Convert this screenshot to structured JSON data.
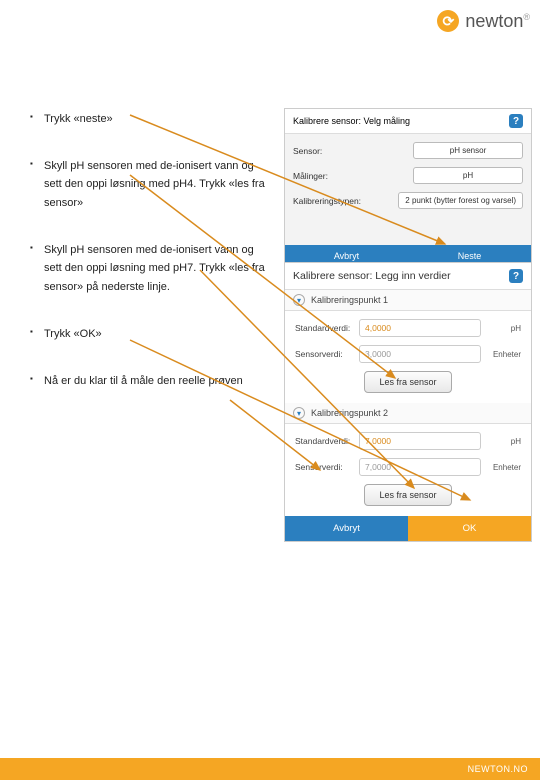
{
  "header": {
    "logo_glyph": "⟳",
    "logo_text": "newton",
    "logo_reg": "®"
  },
  "bullets": [
    "Trykk «neste»",
    "Skyll pH sensoren med de-ionisert vann og sett den oppi løsning med pH4. Trykk «les fra sensor»",
    "Skyll pH sensoren med de-ionisert vann og sett den oppi løsning med pH7. Trykk «les fra sensor» på nederste linje.",
    "Trykk «OK»",
    "Nå er du klar til å måle den reelle prøven"
  ],
  "panel1": {
    "title": "Kalibrere sensor: Velg måling",
    "rows": [
      {
        "label": "Sensor:",
        "value": "pH sensor"
      },
      {
        "label": "Målinger:",
        "value": "pH"
      },
      {
        "label": "Kalibreringstypen:",
        "value": "2 punkt (bytter forest og varsel)"
      }
    ],
    "cancel": "Avbryt",
    "next": "Neste"
  },
  "panel2": {
    "title": "Kalibrere sensor: Legg inn verdier",
    "section1": "Kalibreringspunkt 1",
    "section2": "Kalibreringspunkt 2",
    "std_label": "Standardverdi:",
    "sensor_label": "Sensorverdi:",
    "unit_ph": "pH",
    "unit_enh": "Enheter",
    "read_btn": "Les fra sensor",
    "read_btn2": "Les fra sensor",
    "std1": "4,0000",
    "sv1": "3,0000",
    "std2": "7,0000",
    "sv2": "7,0000",
    "cancel": "Avbryt",
    "ok": "OK"
  },
  "footer": {
    "url": "NEWTON.NO"
  }
}
